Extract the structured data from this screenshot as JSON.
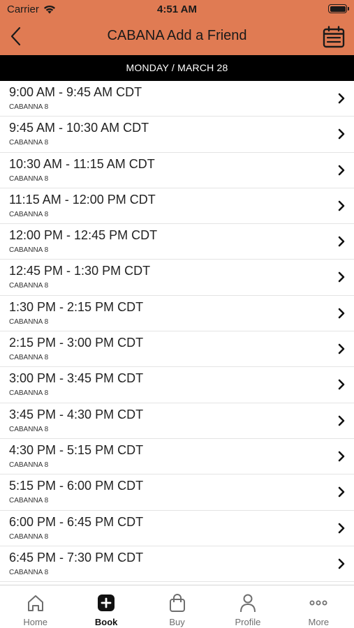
{
  "status": {
    "carrier": "Carrier",
    "time": "4:51 AM"
  },
  "nav": {
    "title": "CABANA Add a Friend"
  },
  "date_label": "MONDAY / MARCH 28",
  "slots": [
    {
      "time": "9:00 AM - 9:45 AM CDT",
      "location": "CABANNA 8"
    },
    {
      "time": "9:45 AM - 10:30 AM CDT",
      "location": "CABANNA 8"
    },
    {
      "time": "10:30 AM - 11:15 AM CDT",
      "location": "CABANNA 8"
    },
    {
      "time": "11:15 AM - 12:00 PM CDT",
      "location": "CABANNA 8"
    },
    {
      "time": "12:00 PM - 12:45 PM CDT",
      "location": "CABANNA 8"
    },
    {
      "time": "12:45 PM - 1:30 PM CDT",
      "location": "CABANNA 8"
    },
    {
      "time": "1:30 PM - 2:15 PM CDT",
      "location": "CABANNA 8"
    },
    {
      "time": "2:15 PM - 3:00 PM CDT",
      "location": "CABANNA 8"
    },
    {
      "time": "3:00 PM - 3:45 PM CDT",
      "location": "CABANNA 8"
    },
    {
      "time": "3:45 PM - 4:30 PM CDT",
      "location": "CABANNA 8"
    },
    {
      "time": "4:30 PM - 5:15 PM CDT",
      "location": "CABANNA 8"
    },
    {
      "time": "5:15 PM - 6:00 PM CDT",
      "location": "CABANNA 8"
    },
    {
      "time": "6:00 PM - 6:45 PM CDT",
      "location": "CABANNA 8"
    },
    {
      "time": "6:45 PM - 7:30 PM CDT",
      "location": "CABANNA 8"
    }
  ],
  "tabs": [
    {
      "label": "Home",
      "icon": "home-icon",
      "active": false
    },
    {
      "label": "Book",
      "icon": "book-plus-icon",
      "active": true
    },
    {
      "label": "Buy",
      "icon": "shopping-bag-icon",
      "active": false
    },
    {
      "label": "Profile",
      "icon": "person-icon",
      "active": false
    },
    {
      "label": "More",
      "icon": "more-dots-icon",
      "active": false
    }
  ],
  "colors": {
    "header": "#e07b53",
    "date_bar": "#000000",
    "active_tab": "#111111",
    "inactive_tab": "#6e6e6e"
  }
}
